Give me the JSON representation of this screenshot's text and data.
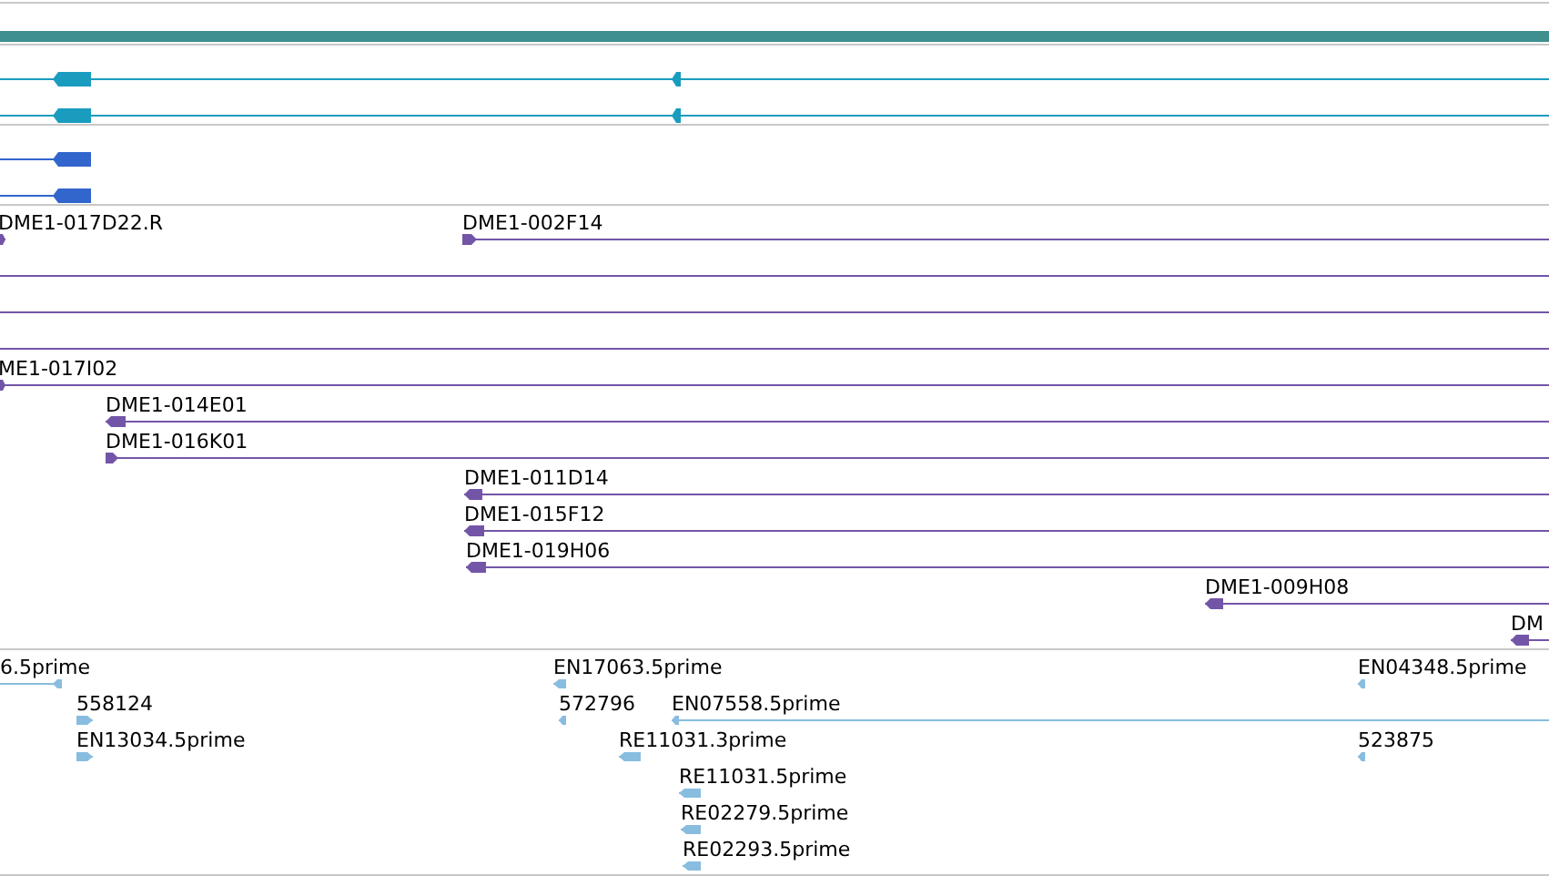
{
  "tracks": [
    {
      "kind": "bar",
      "color": "#3f8f8f"
    },
    {
      "kind": "transcripts",
      "color": "#1a9cbf",
      "features": [
        {
          "kind": "feature",
          "reverse": true
        },
        {
          "kind": "feature",
          "reverse": true
        }
      ]
    },
    {
      "kind": "transcripts",
      "color": "#3366cc",
      "features": [
        {
          "kind": "feature",
          "reverse": true
        },
        {
          "kind": "feature",
          "reverse": true
        }
      ]
    },
    {
      "kind": "clones",
      "color": "#7355a8",
      "features": [
        {
          "kind": "feature",
          "label": "DME1-017D22.R",
          "reverse": false
        },
        {
          "kind": "feature",
          "label": "DME1-002F14",
          "reverse": false
        },
        {
          "kind": "line"
        },
        {
          "kind": "line"
        },
        {
          "kind": "line"
        },
        {
          "kind": "feature",
          "label": "ME1-017I02",
          "reverse": false
        },
        {
          "kind": "feature",
          "label": "DME1-014E01",
          "reverse": true
        },
        {
          "kind": "feature",
          "label": "DME1-016K01",
          "reverse": false
        },
        {
          "kind": "feature",
          "label": "DME1-011D14",
          "reverse": true
        },
        {
          "kind": "feature",
          "label": "DME1-015F12",
          "reverse": true
        },
        {
          "kind": "feature",
          "label": "DME1-019H06",
          "reverse": true
        },
        {
          "kind": "feature",
          "label": "DME1-009H08",
          "reverse": true
        },
        {
          "kind": "feature",
          "label": "DM",
          "reverse": true
        }
      ]
    },
    {
      "kind": "ests",
      "color": "#88bde0",
      "features": [
        {
          "kind": "feature",
          "label": "6.5prime",
          "reverse": true
        },
        {
          "kind": "feature",
          "label": "558124",
          "reverse": false
        },
        {
          "kind": "feature",
          "label": "EN13034.5prime",
          "reverse": false
        },
        {
          "kind": "feature",
          "label": "EN17063.5prime",
          "reverse": true
        },
        {
          "kind": "feature",
          "label": "572796",
          "reverse": true
        },
        {
          "kind": "feature",
          "label": "EN07558.5prime",
          "reverse": true
        },
        {
          "kind": "feature",
          "label": "RE11031.3prime",
          "reverse": true
        },
        {
          "kind": "feature",
          "label": "RE11031.5prime",
          "reverse": true
        },
        {
          "kind": "feature",
          "label": "RE02279.5prime",
          "reverse": true
        },
        {
          "kind": "feature",
          "label": "RE02293.5prime",
          "reverse": true
        },
        {
          "kind": "feature",
          "label": "EN04348.5prime",
          "reverse": true
        },
        {
          "kind": "feature",
          "label": "523875",
          "reverse": true
        }
      ]
    }
  ]
}
